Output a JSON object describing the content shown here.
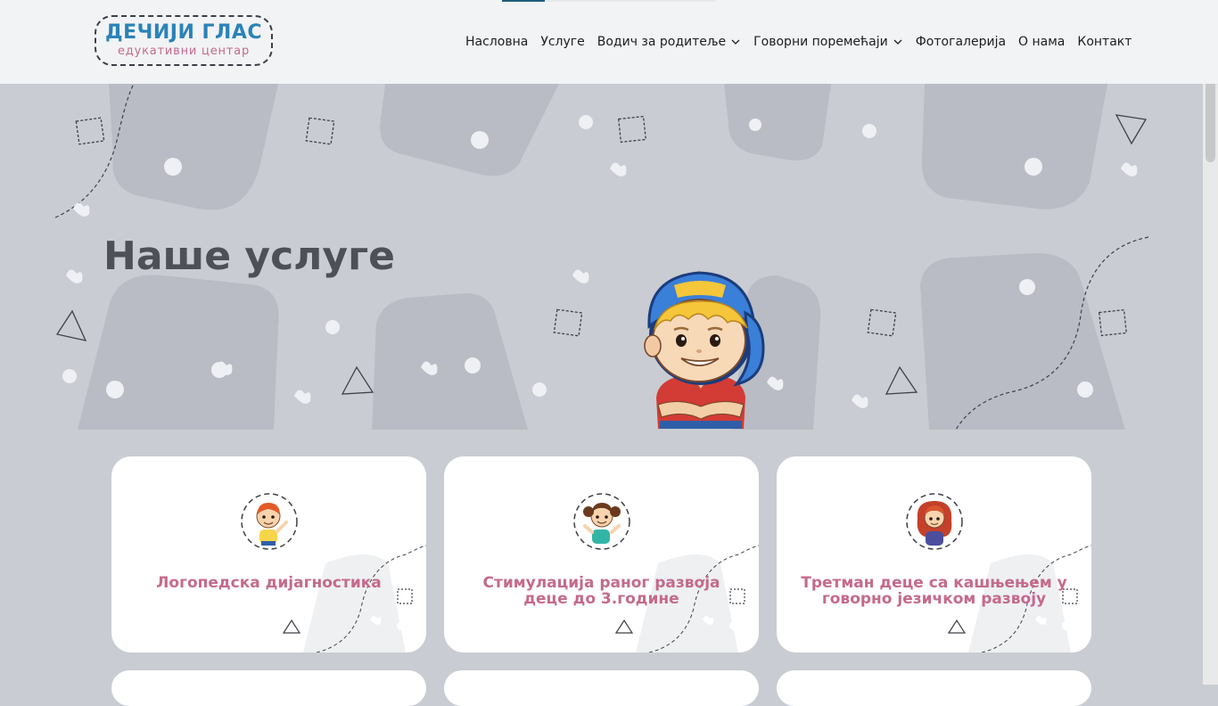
{
  "header": {
    "logo": {
      "title": "ДЕЧИЈИ ГЛАС",
      "subtitle": "едукативни центар"
    },
    "progress": 0.2,
    "nav": [
      {
        "label": "Насловна",
        "dropdown": false
      },
      {
        "label": "Услуге",
        "dropdown": false
      },
      {
        "label": "Водич за родитеље",
        "dropdown": true
      },
      {
        "label": "Говорни поремећаји",
        "dropdown": true
      },
      {
        "label": "Фотогалерија",
        "dropdown": false
      },
      {
        "label": "О нама",
        "dropdown": false
      },
      {
        "label": "Контакт",
        "dropdown": false
      }
    ]
  },
  "hero": {
    "title": "Наше услуге"
  },
  "services": [
    {
      "title": "Логопедска дијагностика",
      "avatar": "boy-waving"
    },
    {
      "title": "Стимулација раног развоја деце до 3.године",
      "avatar": "girl-waving"
    },
    {
      "title": "Третман деце са кашњењем у говорно језичком развоју",
      "avatar": "girl-redhead"
    }
  ],
  "colors": {
    "accent": "#2a83b8",
    "pink": "#c46a8c",
    "text": "#4d5157"
  }
}
